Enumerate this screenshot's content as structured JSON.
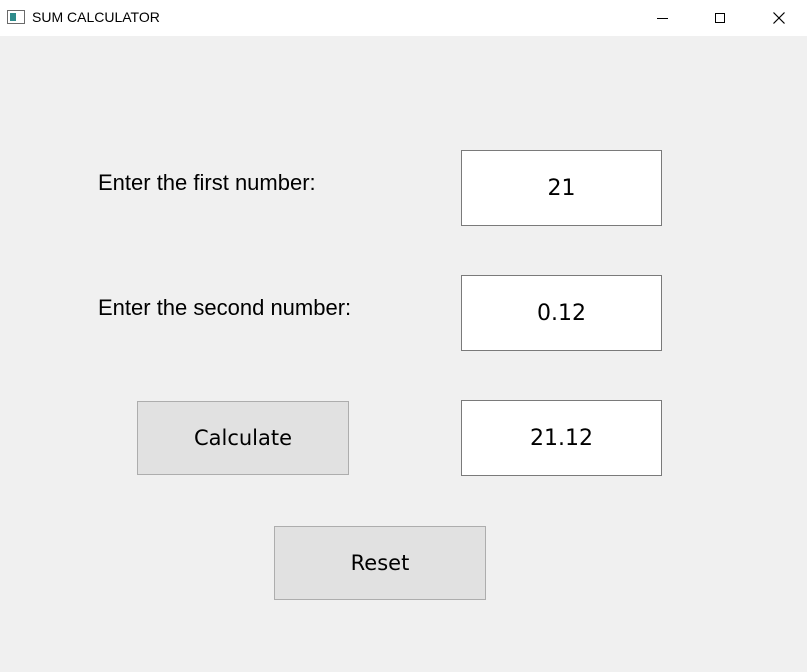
{
  "window": {
    "title": "SUM CALCULATOR",
    "controls": {
      "minimize_icon": "minimize-icon",
      "maximize_icon": "maximize-icon",
      "close_icon": "close-icon",
      "close_glyph": "✕"
    }
  },
  "form": {
    "first_label": "Enter the first number:",
    "first_value": "21",
    "second_label": "Enter the second number:",
    "second_value": "0.12",
    "result_value": "21.12",
    "calculate_label": "Calculate",
    "reset_label": "Reset"
  },
  "colors": {
    "background": "#f0f0f0",
    "titlebar": "#ffffff",
    "button_face": "#e1e1e1",
    "button_border": "#adadad",
    "field_border": "#7a7a7a"
  }
}
